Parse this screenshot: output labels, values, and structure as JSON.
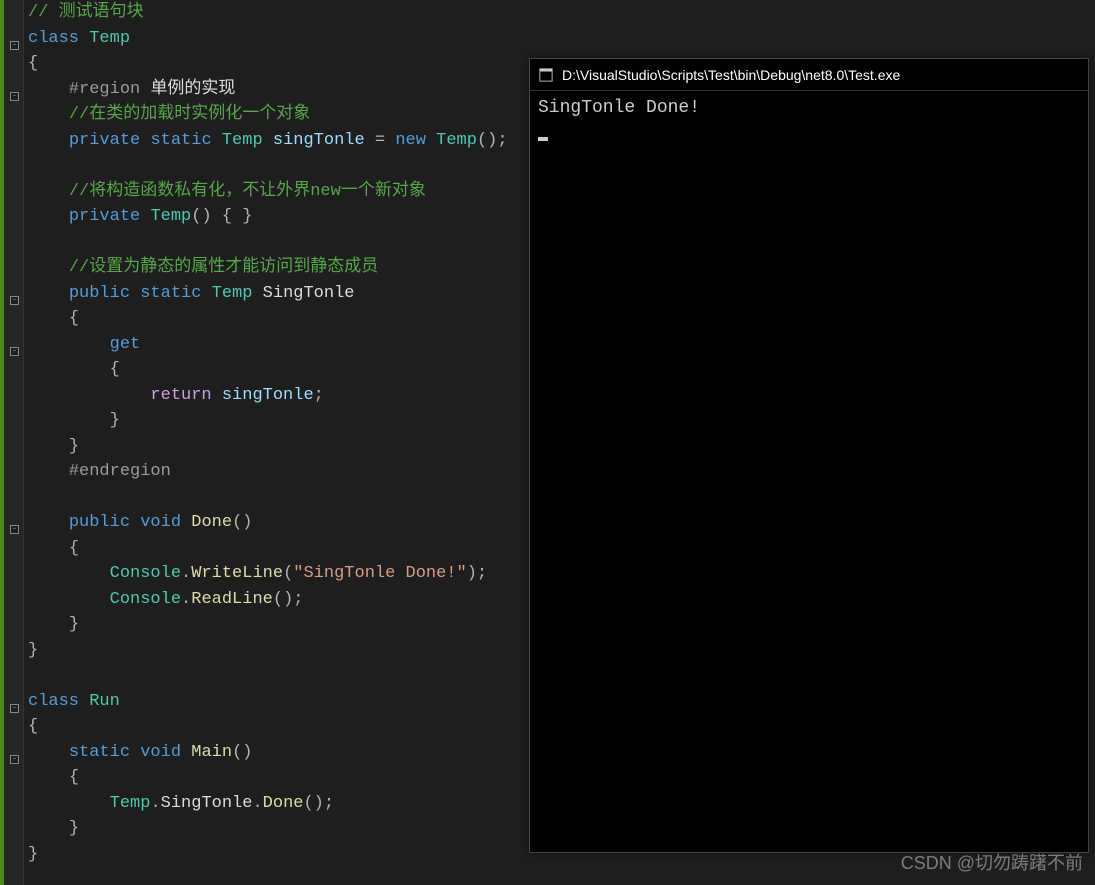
{
  "code": {
    "comment_test": "// 测试语句块",
    "class_temp": "class",
    "temp_name": "Temp",
    "brace_open": "{",
    "brace_close": "}",
    "region_start": "#region",
    "region_label": "单例的实现",
    "cmt_instantiate": "//在类的加载时实例化一个对象",
    "private_kw": "private",
    "static_kw": "static",
    "singtonle_field": "singTonle",
    "new_kw": "new",
    "temp_ctor_call": "Temp",
    "cmt_private_ctor": "//将构造函数私有化，不让外界new一个新对象",
    "ctor_decl": "Temp",
    "cmt_static_prop": "//设置为静态的属性才能访问到静态成员",
    "public_kw": "public",
    "prop_name": "SingTonle",
    "get_kw": "get",
    "return_kw": "return",
    "endregion": "#endregion",
    "void_kw": "void",
    "done_method": "Done",
    "console_class": "Console",
    "writeline_method": "WriteLine",
    "writeline_arg": "\"SingTonle Done!\"",
    "readline_method": "ReadLine",
    "class_run": "Run",
    "main_method": "Main",
    "done_call": "Done",
    "semicolon": ";",
    "equals": "=",
    "parens": "()",
    "paren_open": "(",
    "paren_close": ")",
    "dot": "."
  },
  "console": {
    "title": "D:\\VisualStudio\\Scripts\\Test\\bin\\Debug\\net8.0\\Test.exe",
    "output_line1": "SingTonle Done!"
  },
  "watermark": "CSDN @切勿踌躇不前"
}
